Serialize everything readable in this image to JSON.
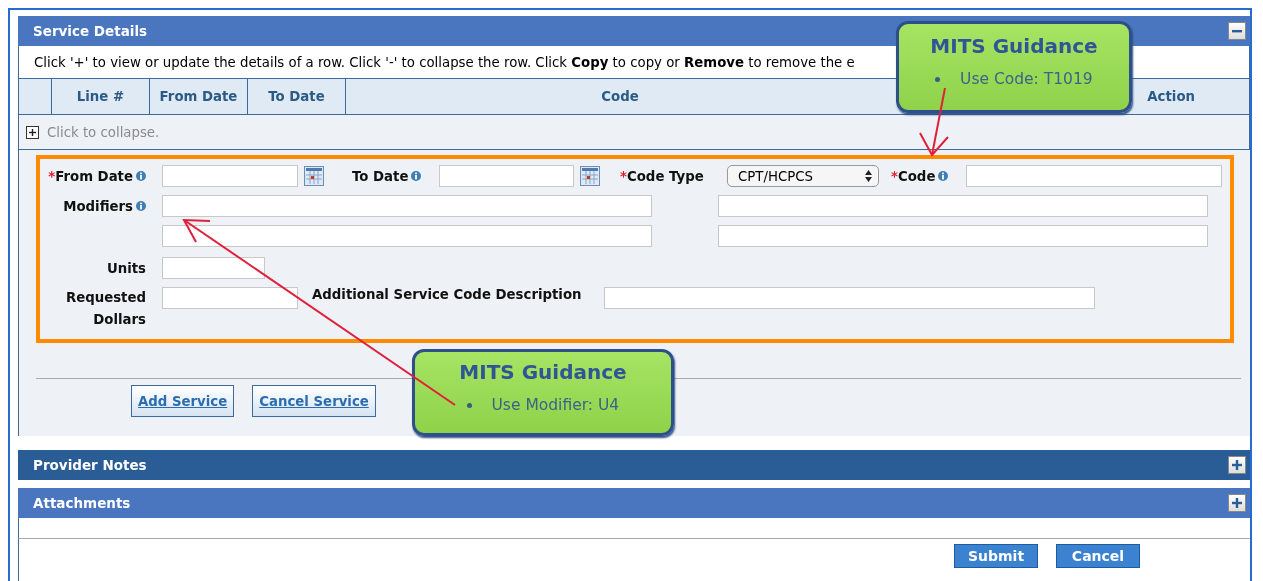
{
  "service_details": {
    "title": "Service Details",
    "expanded": true,
    "instruction": "Click '+' to view or update the details of a row. Click '-' to collapse the row. Click **Copy** to copy or **Remove** to remove the e",
    "table": {
      "columns": [
        "Line #",
        "From Date",
        "To Date",
        "Code",
        "Action"
      ]
    },
    "collapse_row": {
      "text": "Click to collapse."
    },
    "form": {
      "from_date": {
        "label": "From Date",
        "required_mark": "*",
        "info": true
      },
      "to_date": {
        "label": "To Date",
        "info": true
      },
      "code_type": {
        "label": "Code Type",
        "required_mark": "*",
        "value": "CPT/HCPCS"
      },
      "code": {
        "label": "Code",
        "required_mark": "*",
        "info": true
      },
      "modifiers": {
        "label": "Modifiers",
        "info": true
      },
      "units": {
        "label": "Units"
      },
      "requested_dollars": {
        "label": "Requested Dollars"
      },
      "additional_description": {
        "label": "Additional Service Code Description"
      }
    },
    "buttons": [
      "Add Service",
      "Cancel Service"
    ]
  },
  "collapsed_sections": [
    {
      "title": "Provider Notes",
      "expanded": false,
      "highlighted": true
    },
    {
      "title": "Attachments",
      "expanded": false,
      "highlighted": false
    }
  ],
  "footer_buttons": [
    "Submit",
    "Cancel"
  ],
  "callouts": [
    {
      "title": "MITS Guidance",
      "bullet": "Use Code: T1019"
    },
    {
      "title": "MITS Guidance",
      "bullet": "Use Modifier: U4"
    }
  ]
}
